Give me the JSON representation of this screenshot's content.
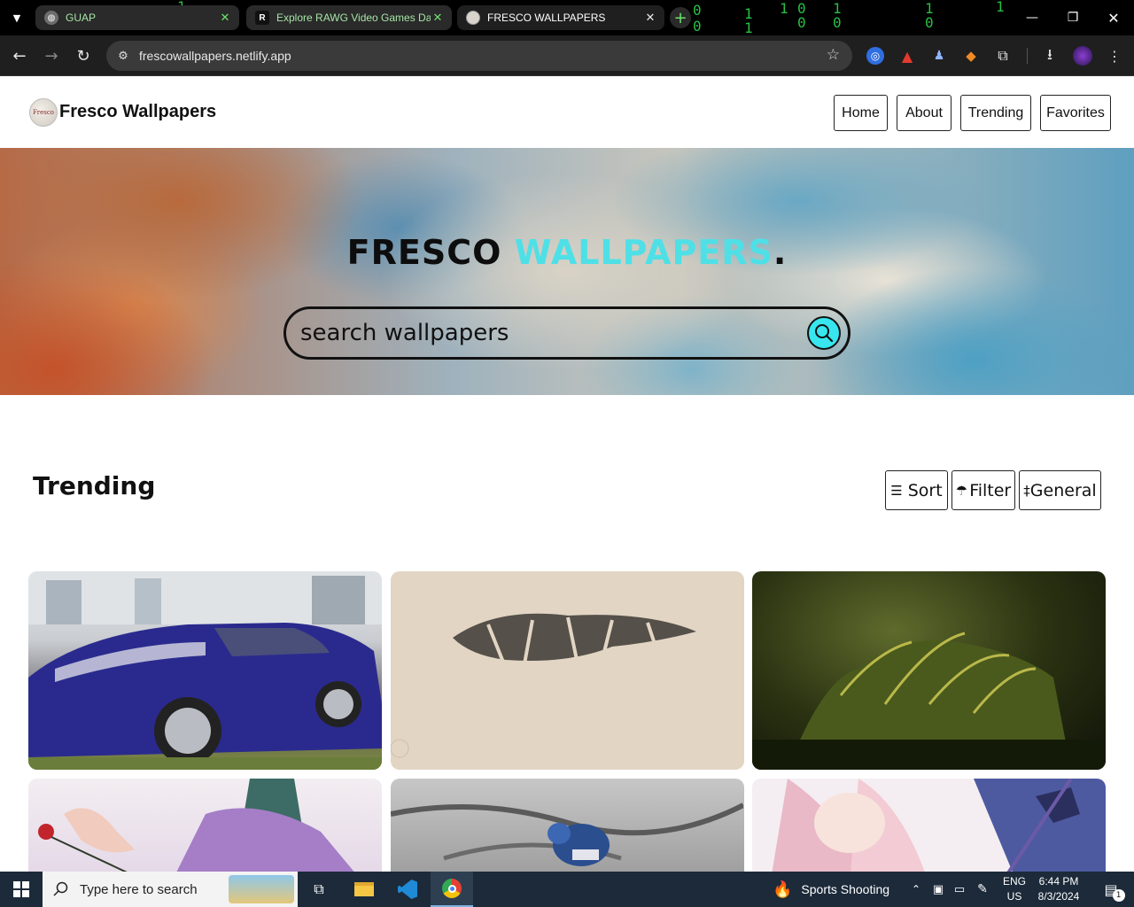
{
  "browser": {
    "tabs": [
      {
        "title": "GUAP",
        "close": "✕"
      },
      {
        "title": "Explore RAWG Video Games Da",
        "favicon": "R",
        "close": "✕"
      },
      {
        "title": "FRESCO WALLPAPERS",
        "close": "✕"
      }
    ],
    "new_tab": "+",
    "url": "frescowallpapers.netlify.app",
    "colors": {
      "tab_text": "#a6e4a6",
      "matrix": "#2fd34b"
    }
  },
  "site": {
    "brand_name": "Fresco Wallpapers",
    "logo_text": "Fresco",
    "nav": [
      "Home",
      "About",
      "Trending",
      "Favorites"
    ],
    "hero": {
      "title_part1": "FRESCO",
      "title_part2": "WALLPAPERS",
      "title_part3": ".",
      "search_placeholder": "search wallpapers"
    },
    "section_title": "Trending",
    "controls": {
      "sort": "Sort",
      "filter": "Filter",
      "general": "General"
    },
    "colors": {
      "accent": "#37e6ee",
      "title_accent": "#4ee0e6"
    }
  },
  "taskbar": {
    "search_placeholder": "Type here to search",
    "weather_text": "Sports Shooting",
    "lang_line1": "ENG",
    "lang_line2": "US",
    "time": "6:44 PM",
    "date": "8/3/2024",
    "notification_count": "1"
  }
}
